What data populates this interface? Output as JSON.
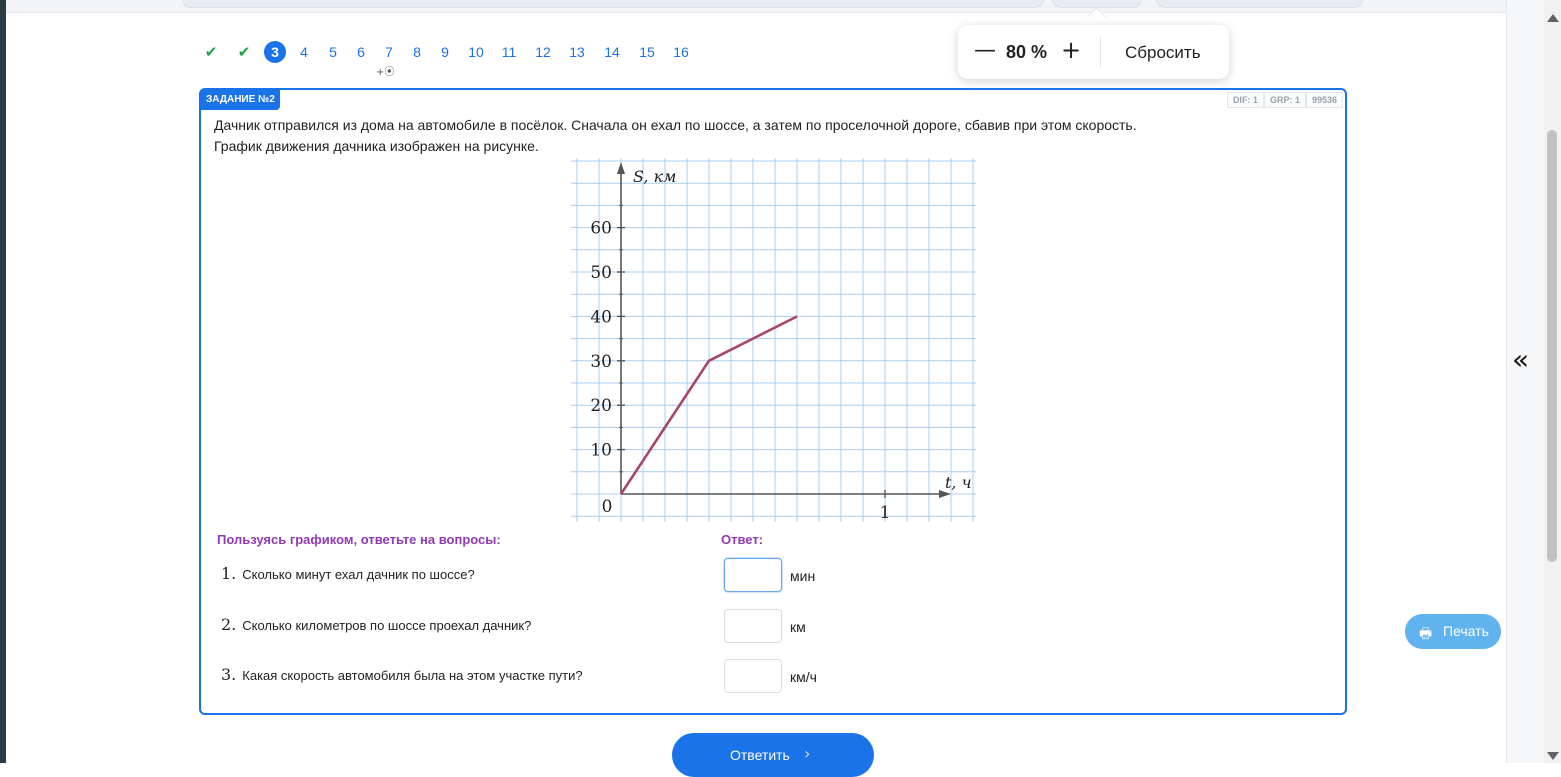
{
  "pager": {
    "done": [
      "✔",
      "✔"
    ],
    "items": [
      "3",
      "4",
      "5",
      "6",
      "7",
      "8",
      "9",
      "10",
      "11",
      "12",
      "13",
      "14",
      "15",
      "16"
    ],
    "current": "3",
    "sub_mark": "+⦿"
  },
  "zoom": {
    "minus": "—",
    "value": "80 %",
    "plus": "+",
    "reset": "Сбросить"
  },
  "task": {
    "tag": "ЗАДАНИЕ №2",
    "meta": [
      "DIF: 1",
      "GRP: 1",
      "99536"
    ],
    "text_line1": "Дачник отправился из дома на автомобиле в посёлок. Сначала он ехал по шоссе, а затем по проселочной дороге, сбавив при этом скорость.",
    "text_line2": "График движения дачника изображен на рисунке."
  },
  "chart_data": {
    "type": "line",
    "ylabel": "S, км",
    "xlabel": "t, ч",
    "origin_label": "0",
    "y_ticks": [
      "10",
      "20",
      "30",
      "40",
      "50",
      "60"
    ],
    "x_ticks": [
      "1"
    ],
    "xlim": [
      -0.2,
      1.35
    ],
    "ylim": [
      -6,
      75
    ],
    "grid": true,
    "series": [
      {
        "x": [
          0,
          0.333,
          0.667
        ],
        "y": [
          0,
          30,
          40
        ],
        "color": "#a8456b"
      }
    ]
  },
  "questions_header": "Пользуясь графиком, ответьте на вопросы:",
  "answer_header": "Ответ:",
  "questions": [
    {
      "num": "1.",
      "text": "Сколько минут ехал дачник по шоссе?",
      "value": "",
      "unit": "мин"
    },
    {
      "num": "2.",
      "text": "Сколько километров по шоссе проехал дачник?",
      "value": "",
      "unit": "км"
    },
    {
      "num": "3.",
      "text": "Какая скорость автомобиля была на этом участке пути?",
      "value": "",
      "unit": "км/ч"
    }
  ],
  "submit": {
    "label": "Ответить",
    "arrow": "›"
  },
  "print": {
    "icon": "🖶",
    "label": "Печать"
  },
  "sidebar": {
    "collapse_icon": "«"
  },
  "colors": {
    "accent": "#1a73e8",
    "check": "#1ea446",
    "header": "#8e3bb4",
    "series": "#a8456b",
    "print": "#61b3f0"
  }
}
